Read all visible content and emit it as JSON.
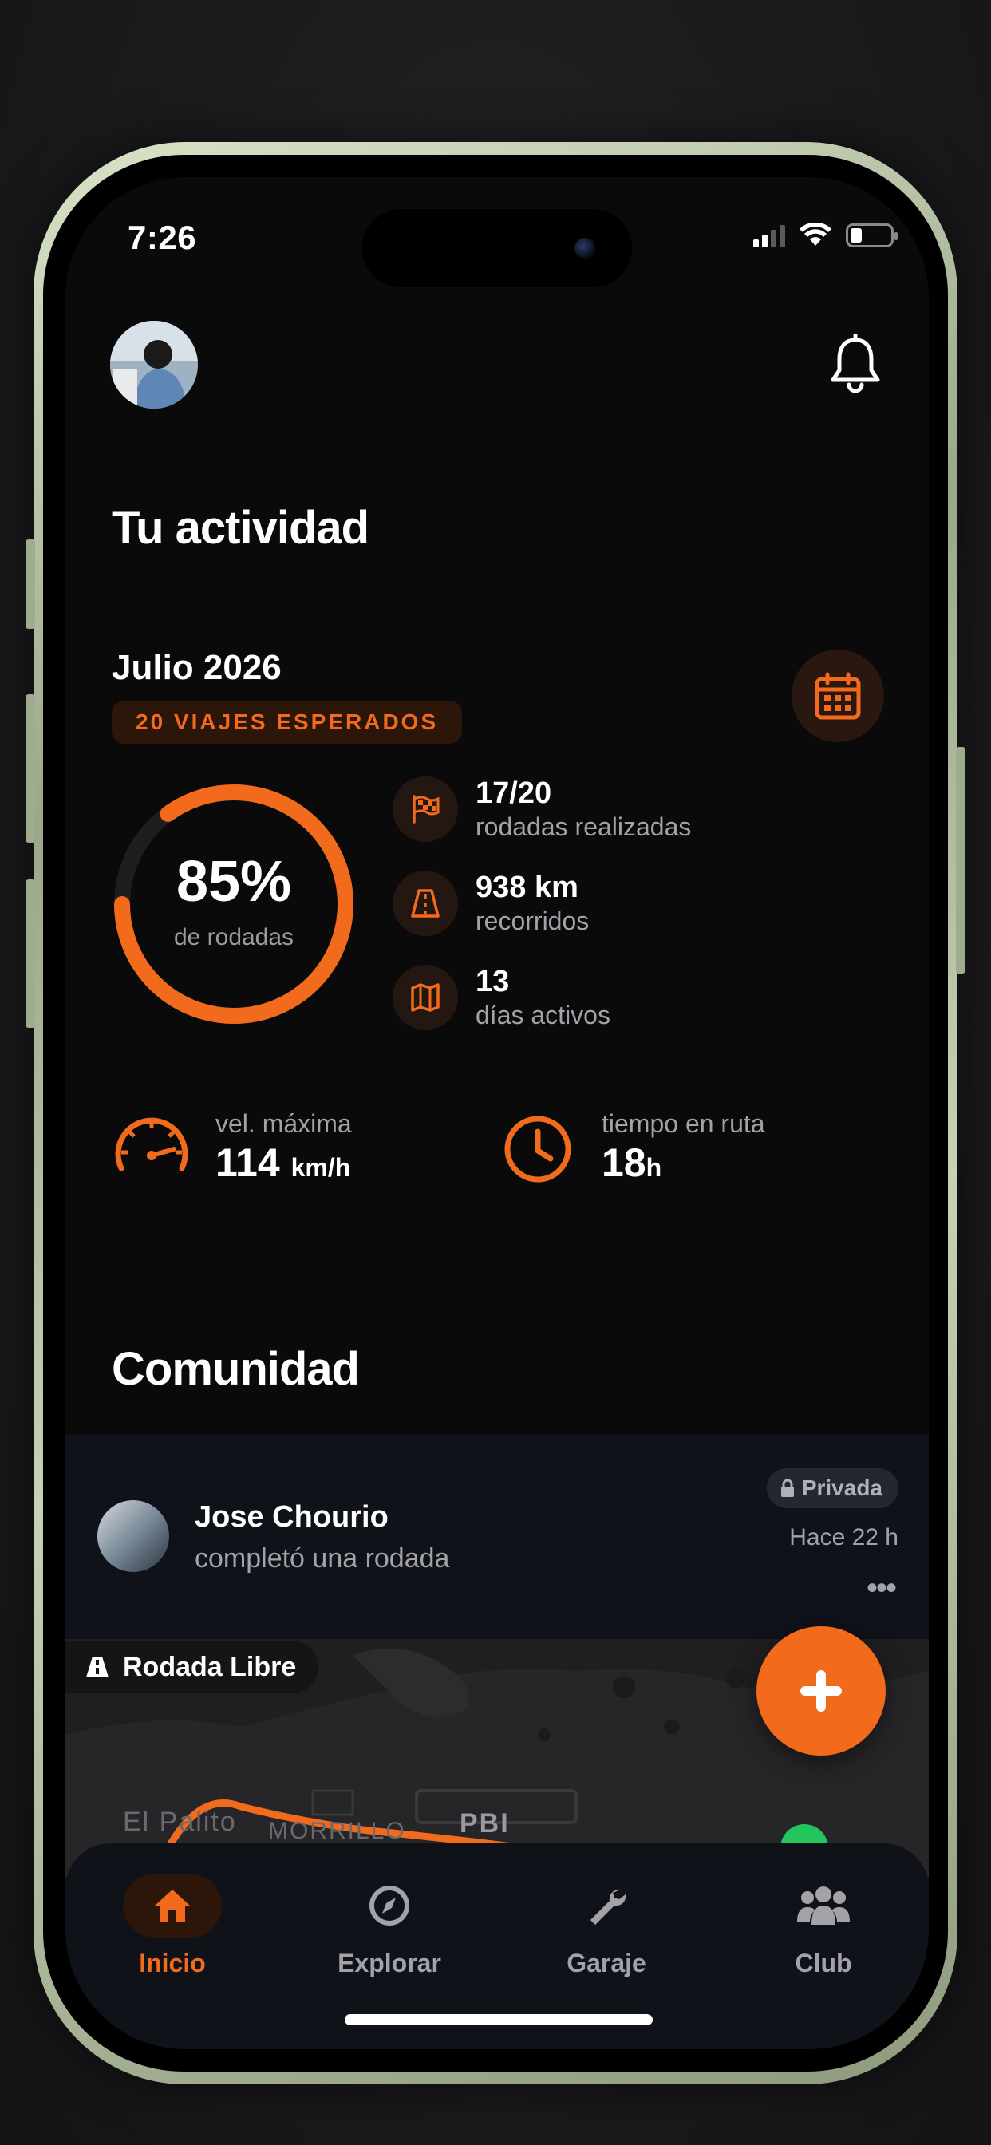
{
  "status_bar": {
    "time": "7:26"
  },
  "header": {
    "title": "Tu actividad"
  },
  "activity": {
    "month": "Julio 2026",
    "expected_badge": "20 VIAJES ESPERADOS",
    "ring": {
      "percent_label": "85%",
      "caption": "de rodadas",
      "progress": 0.85
    },
    "stats": [
      {
        "value": "17/20",
        "label": "rodadas realizadas",
        "icon": "checkered-flag-icon"
      },
      {
        "value": "938 km",
        "label": "recorridos",
        "icon": "road-icon"
      },
      {
        "value": "13",
        "label": "días activos",
        "icon": "map-icon"
      }
    ],
    "max_speed": {
      "label": "vel. máxima",
      "value": "114",
      "unit": "km/h"
    },
    "route_time": {
      "label": "tiempo en ruta",
      "value": "18",
      "unit": "h"
    }
  },
  "community": {
    "title": "Comunidad",
    "post": {
      "user": "Jose Chourio",
      "action": "completó una rodada",
      "privacy": "Privada",
      "time": "Hace 22 h",
      "more": "•••",
      "ride_type": "Rodada Libre",
      "map_labels": [
        "El Palito",
        "MORRILLO",
        "PBI"
      ]
    }
  },
  "tabbar": {
    "items": [
      {
        "label": "Inicio",
        "icon": "home-icon",
        "active": true
      },
      {
        "label": "Explorar",
        "icon": "compass-icon",
        "active": false
      },
      {
        "label": "Garaje",
        "icon": "wrench-icon",
        "active": false
      },
      {
        "label": "Club",
        "icon": "users-icon",
        "active": false
      }
    ]
  },
  "colors": {
    "accent": "#f26b1d",
    "background": "#0a0a0b",
    "card": "#0f1218"
  }
}
